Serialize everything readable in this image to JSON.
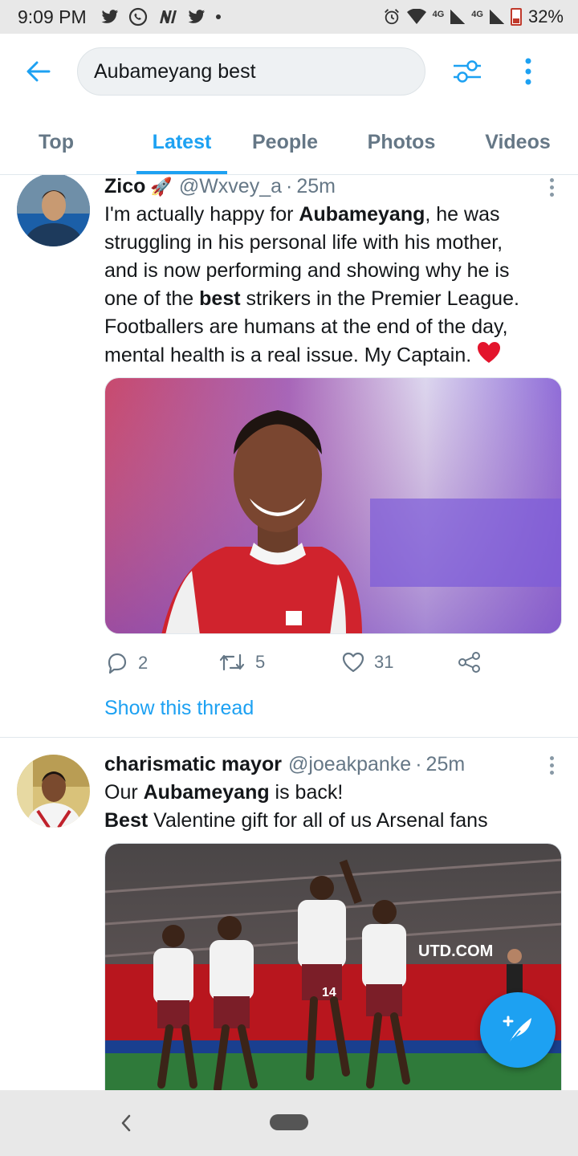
{
  "status_bar": {
    "time": "9:09 PM",
    "notification_icons": [
      "twitter-icon",
      "whatsapp-icon",
      "news-icon",
      "twitter-icon",
      "dot-icon"
    ],
    "network_label_1": "4G",
    "network_label_2": "4G",
    "battery_percent": "32%"
  },
  "header": {
    "search_value": "Aubameyang best"
  },
  "tabs": [
    {
      "label": "Top",
      "active": false
    },
    {
      "label": "Latest",
      "active": true
    },
    {
      "label": "People",
      "active": false
    },
    {
      "label": "Photos",
      "active": false
    },
    {
      "label": "Videos",
      "active": false
    }
  ],
  "tweets": [
    {
      "name": "Zico",
      "name_emoji": "🚀",
      "handle": "@Wxvey_a",
      "separator": "·",
      "time": "25m",
      "text_lines": [
        [
          "I'm actually happy for ",
          "Aubameyang",
          ", he was"
        ],
        [
          "struggling in his personal life with his mother,"
        ],
        [
          "and is now performing and showing why he is"
        ],
        [
          "one of the ",
          "best",
          " strikers in the Premier League."
        ],
        [
          "Footballers are humans at the end of the day,"
        ],
        [
          "mental health is a real issue. My Captain. "
        ]
      ],
      "end_emoji": "❤️",
      "replies": "2",
      "retweets": "5",
      "likes": "31",
      "show_thread": "Show this thread"
    },
    {
      "name": "charismatic mayor",
      "handle": "@joeakpanke",
      "separator": "·",
      "time": "25m",
      "line1_a": "Our ",
      "line1_b": "Aubameyang",
      "line1_c": " is back!",
      "line2_a": "Best",
      "line2_b": " Valentine gift for all of us Arsenal fans",
      "photo_banner_text": "UTD.COM",
      "photo_shirt_number": "14"
    }
  ],
  "colors": {
    "accent": "#1da1f2",
    "text_primary": "#14171a",
    "text_secondary": "#657786",
    "heart": "#e0245e"
  }
}
